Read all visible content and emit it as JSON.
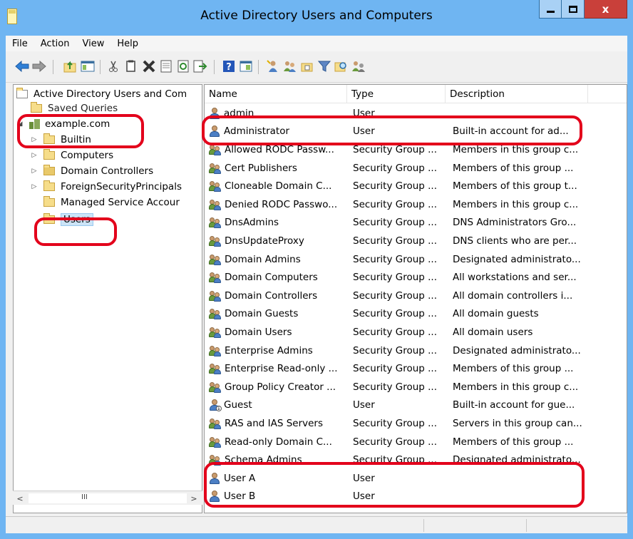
{
  "window": {
    "title": "Active Directory Users and Computers",
    "close_glyph": "x"
  },
  "menu": [
    "File",
    "Action",
    "View",
    "Help"
  ],
  "toolbar_icons": [
    "back-arrow-icon",
    "forward-arrow-icon",
    "up-folder-icon",
    "show-tree-icon",
    "cut-icon",
    "copy-icon",
    "delete-icon",
    "properties-icon",
    "refresh-icon",
    "export-list-icon",
    "help-icon",
    "mmc-icon",
    "new-user-icon",
    "new-group-icon",
    "new-ou-icon",
    "filter-icon",
    "find-icon",
    "add-to-group-icon"
  ],
  "tree": {
    "root": "Active Directory Users and Com",
    "items": [
      {
        "label": "Saved Queries",
        "indent": 1
      },
      {
        "label": "example.com",
        "indent": 1,
        "expanded": true
      },
      {
        "label": "Builtin",
        "indent": 2
      },
      {
        "label": "Computers",
        "indent": 2
      },
      {
        "label": "Domain Controllers",
        "indent": 2
      },
      {
        "label": "ForeignSecurityPrincipals",
        "indent": 2
      },
      {
        "label": "Managed Service Accour",
        "indent": 2
      },
      {
        "label": "Users",
        "indent": 2,
        "selected": true
      }
    ],
    "scroll_grip": "III"
  },
  "list": {
    "columns": [
      "Name",
      "Type",
      "Description"
    ],
    "rows": [
      {
        "name": "admin",
        "type": "User",
        "description": "",
        "icon": "user"
      },
      {
        "name": "Administrator",
        "type": "User",
        "description": "Built-in account for ad...",
        "icon": "user"
      },
      {
        "name": "Allowed RODC Passw...",
        "type": "Security Group ...",
        "description": "Members in this group c...",
        "icon": "group"
      },
      {
        "name": "Cert Publishers",
        "type": "Security Group ...",
        "description": "Members of this group ...",
        "icon": "group"
      },
      {
        "name": "Cloneable Domain C...",
        "type": "Security Group ...",
        "description": "Members of this group t...",
        "icon": "group"
      },
      {
        "name": "Denied RODC Passwo...",
        "type": "Security Group ...",
        "description": "Members in this group c...",
        "icon": "group"
      },
      {
        "name": "DnsAdmins",
        "type": "Security Group ...",
        "description": "DNS Administrators Gro...",
        "icon": "group"
      },
      {
        "name": "DnsUpdateProxy",
        "type": "Security Group ...",
        "description": "DNS clients who are per...",
        "icon": "group"
      },
      {
        "name": "Domain Admins",
        "type": "Security Group ...",
        "description": "Designated administrato...",
        "icon": "group"
      },
      {
        "name": "Domain Computers",
        "type": "Security Group ...",
        "description": "All workstations and ser...",
        "icon": "group"
      },
      {
        "name": "Domain Controllers",
        "type": "Security Group ...",
        "description": "All domain controllers i...",
        "icon": "group"
      },
      {
        "name": "Domain Guests",
        "type": "Security Group ...",
        "description": "All domain guests",
        "icon": "group"
      },
      {
        "name": "Domain Users",
        "type": "Security Group ...",
        "description": "All domain users",
        "icon": "group"
      },
      {
        "name": "Enterprise Admins",
        "type": "Security Group ...",
        "description": "Designated administrato...",
        "icon": "group"
      },
      {
        "name": "Enterprise Read-only ...",
        "type": "Security Group ...",
        "description": "Members of this group ...",
        "icon": "group"
      },
      {
        "name": "Group Policy Creator ...",
        "type": "Security Group ...",
        "description": "Members in this group c...",
        "icon": "group"
      },
      {
        "name": "Guest",
        "type": "User",
        "description": "Built-in account for gue...",
        "icon": "guest"
      },
      {
        "name": "RAS and IAS Servers",
        "type": "Security Group ...",
        "description": "Servers in this group can...",
        "icon": "group"
      },
      {
        "name": "Read-only Domain C...",
        "type": "Security Group ...",
        "description": "Members of this group ...",
        "icon": "group"
      },
      {
        "name": "Schema Admins",
        "type": "Security Group ...",
        "description": "Designated administrato...",
        "icon": "group"
      },
      {
        "name": "User A",
        "type": "User",
        "description": "",
        "icon": "user"
      },
      {
        "name": "User B",
        "type": "User",
        "description": "",
        "icon": "user"
      }
    ]
  },
  "colors": {
    "titlebar": "#6fb5f2",
    "close_button": "#c9403a",
    "highlight": "#e3001b"
  }
}
